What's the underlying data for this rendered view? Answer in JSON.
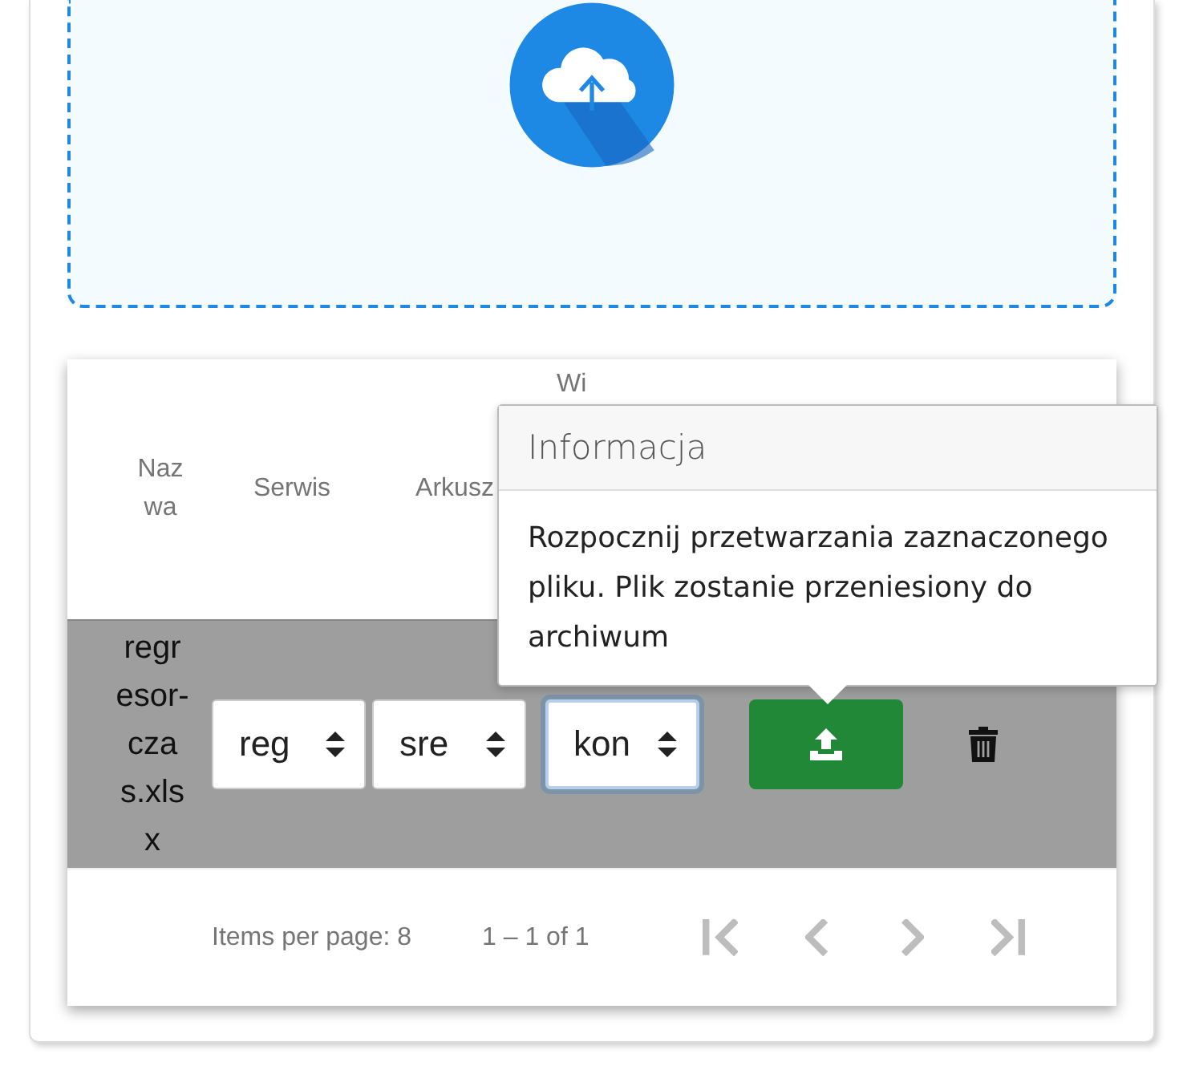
{
  "table": {
    "columns": [
      "Nazwa",
      "Serwis",
      "Arkusz",
      "Wi"
    ],
    "rows": [
      {
        "name": "regresor-czas.xlsx",
        "selected": true,
        "selects": [
          {
            "value": "reg",
            "focused": false
          },
          {
            "value": "sre",
            "focused": false
          },
          {
            "value": "kon",
            "focused": true
          }
        ]
      }
    ]
  },
  "popover": {
    "title": "Informacja",
    "body": "Rozpocznij przetwarzania zaznaczonego pliku. Plik zostanie przeniesiony do archiwum"
  },
  "paginator": {
    "items_per_page": "Items per page: 8",
    "range": "1 – 1 of 1",
    "buttons": [
      {
        "kind": "first",
        "disabled": true
      },
      {
        "kind": "prev",
        "disabled": true
      },
      {
        "kind": "next",
        "disabled": true
      },
      {
        "kind": "last",
        "disabled": true
      }
    ]
  }
}
